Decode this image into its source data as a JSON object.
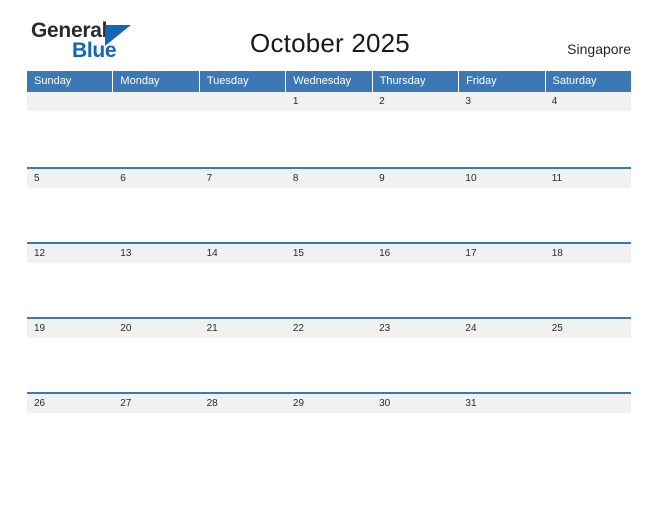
{
  "brand": {
    "name_part1": "General",
    "name_part2": "Blue",
    "triangle_icon": "triangle-icon",
    "color_blue": "#1565b5",
    "color_dark": "#2b2b2b"
  },
  "header": {
    "title": "October 2025",
    "locale": "Singapore"
  },
  "calendar": {
    "accent_color": "#3c78b5",
    "band_color": "#f1f1f1",
    "weekdays": [
      "Sunday",
      "Monday",
      "Tuesday",
      "Wednesday",
      "Thursday",
      "Friday",
      "Saturday"
    ],
    "weeks": [
      [
        "",
        "",
        "",
        "1",
        "2",
        "3",
        "4"
      ],
      [
        "5",
        "6",
        "7",
        "8",
        "9",
        "10",
        "11"
      ],
      [
        "12",
        "13",
        "14",
        "15",
        "16",
        "17",
        "18"
      ],
      [
        "19",
        "20",
        "21",
        "22",
        "23",
        "24",
        "25"
      ],
      [
        "26",
        "27",
        "28",
        "29",
        "30",
        "31",
        ""
      ]
    ]
  }
}
